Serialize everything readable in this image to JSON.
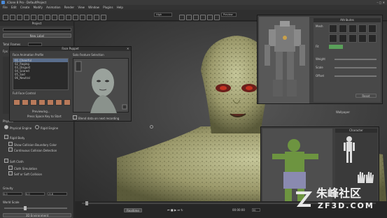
{
  "window": {
    "title": "iClone 8 Pro - DefaultProject"
  },
  "menu": [
    "File",
    "Edit",
    "Create",
    "Modify",
    "Animation",
    "Render",
    "View",
    "Window",
    "Plugins",
    "Help"
  ],
  "toolbar": {
    "quality": "High",
    "preview": "Preview"
  },
  "left_panel": {
    "title": "Project",
    "new_label": "New Label",
    "total_frames_label": "Total Frames",
    "fps_label": "Fps",
    "section_label": "Physics",
    "engine_options": [
      "Physical Engine",
      "Rigid Engine"
    ],
    "checkboxes": [
      "Rigid Body",
      "Show Collision Boundary Color",
      "Continuous Collision Detection",
      "Soft Cloth",
      "Cloth Simulation",
      "Self or Soft Collision"
    ],
    "gravity_label": "Gravity",
    "gravity_values": [
      "0.0",
      "0.0",
      "-9.8"
    ],
    "world_scale_label": "World Scale",
    "footer_button": "3D Environment"
  },
  "face_dialog": {
    "title": "Face Puppet",
    "profile_label": "Face Animation Profile",
    "feature_label": "Solo Feature Selection",
    "profiles": [
      "01_Cheerful",
      "02_Raging",
      "03_Disgust",
      "04_Scared",
      "05_Sad",
      "06_Neutral"
    ],
    "face_control_label": "Full Face Control",
    "previewing": "Previewing...",
    "hint": "Press Space Key to Start",
    "checkbox": "Blend data on next recording"
  },
  "robot_dialog": {
    "title": "Attributes",
    "label_a": "Mesh",
    "label_b": "Fit",
    "slider_labels": [
      "Weight",
      "Scale",
      "Offset"
    ],
    "footer_btn": "Reset"
  },
  "wallpaper_label": "Wallpaper",
  "bottom_right_dialog": {
    "title": "Character"
  },
  "timeline": {
    "realtime": "Realtime",
    "frame": "00:00:00",
    "fps_display": "30"
  },
  "watermark": {
    "logo_text": "朱峰社区",
    "url": "ZF3D.COM"
  }
}
